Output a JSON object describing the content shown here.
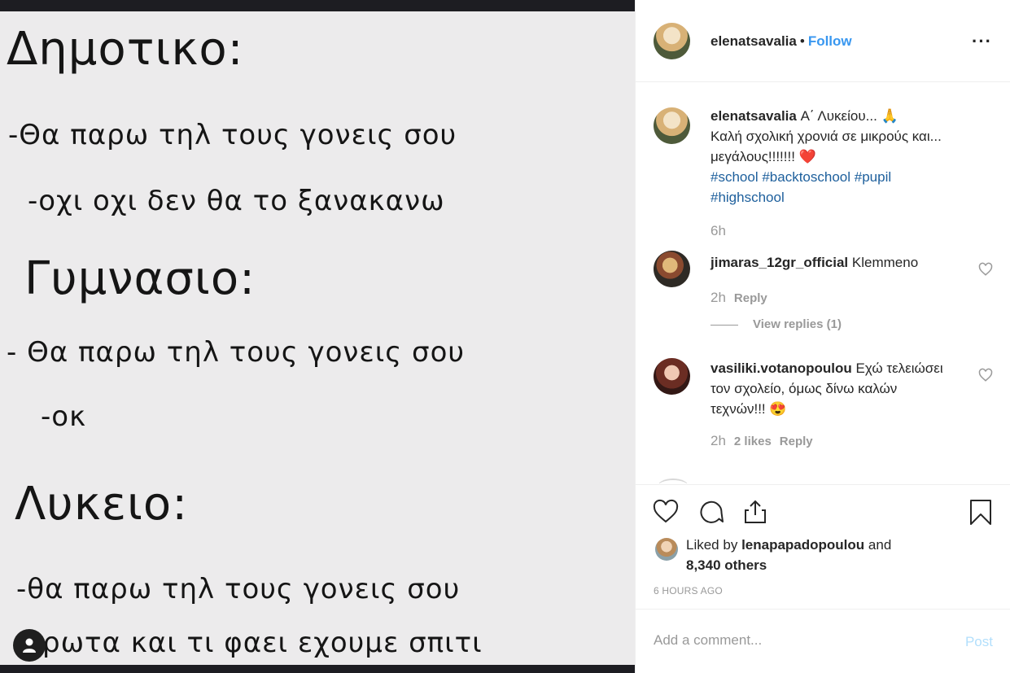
{
  "post_image": {
    "lines": [
      {
        "text": "Δημοτικο:",
        "kind": "heading"
      },
      {
        "text": "-Θα παρω τηλ τους γονεις σου",
        "kind": "text"
      },
      {
        "text": "-οχι οχι δεν θα το ξανακανω",
        "kind": "text"
      },
      {
        "text": "Γυμνασιο:",
        "kind": "heading"
      },
      {
        "text": "- Θα παρω τηλ τους γονεις σου",
        "kind": "text"
      },
      {
        "text": "-οκ",
        "kind": "text"
      },
      {
        "text": "Λυκειο:",
        "kind": "heading"
      },
      {
        "text": "-θα παρω τηλ τους γονεις σου",
        "kind": "text"
      },
      {
        "text": "ρωτα και τι φαει εχουμε σπιτι",
        "kind": "text"
      }
    ],
    "tag_icon": "user-tag-icon"
  },
  "header": {
    "username": "elenatsavalia",
    "separator": "•",
    "follow_label": "Follow",
    "more_label": "···"
  },
  "caption": {
    "username": "elenatsavalia",
    "text_part1": "Α΄ Λυκείου...",
    "emoji_pray": "🙏",
    "text_part2": "Καλή σχολική χρονιά σε μικρούς και... μεγάλους!!!!!!!",
    "emoji_heart": "❤️",
    "hashtags": [
      "#school",
      "#backtoschool",
      "#pupil",
      "#highschool"
    ],
    "time": "6h"
  },
  "comments": [
    {
      "username": "jimaras_12gr_official",
      "text": "Klemmeno",
      "time": "2h",
      "likes": "",
      "reply_label": "Reply",
      "view_replies": "View replies (1)"
    },
    {
      "username": "vasiliki.votanopoulou",
      "text": "Εχώ τελειώσει τον σχολείο, όμως δίνω καλών τεχνών!!!",
      "emoji": "😍",
      "time": "2h",
      "likes": "2 likes",
      "reply_label": "Reply"
    }
  ],
  "likes": {
    "prefix": "Liked by",
    "user": "lenapapadopoulou",
    "conj": "and",
    "others": "8,340 others",
    "time_ago": "6 HOURS AGO"
  },
  "add_comment": {
    "placeholder": "Add a comment...",
    "post_label": "Post"
  },
  "colors": {
    "follow": "#3897f0",
    "hashtag": "#1d5f9c",
    "muted": "#999999",
    "post_disabled": "#b2dffc",
    "heart_red": "#ed4956"
  }
}
